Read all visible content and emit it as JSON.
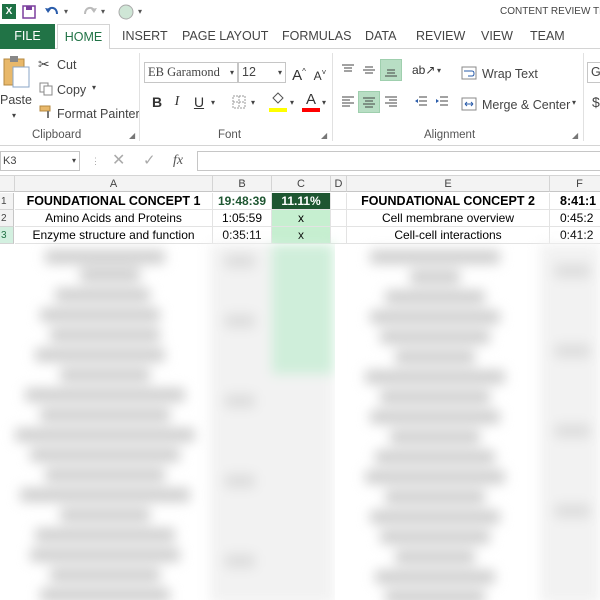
{
  "window": {
    "title": "CONTENT REVIEW TRA"
  },
  "quick_access": {
    "save_icon": "save-icon",
    "undo_icon": "undo-icon",
    "redo_icon": "redo-icon"
  },
  "tabs": [
    {
      "label": "FILE"
    },
    {
      "label": "HOME"
    },
    {
      "label": "INSERT"
    },
    {
      "label": "PAGE LAYOUT"
    },
    {
      "label": "FORMULAS"
    },
    {
      "label": "DATA"
    },
    {
      "label": "REVIEW"
    },
    {
      "label": "VIEW"
    },
    {
      "label": "TEAM"
    }
  ],
  "clipboard": {
    "paste": "Paste",
    "cut": "Cut",
    "copy": "Copy",
    "format_painter": "Format Painter",
    "group_label": "Clipboard"
  },
  "font": {
    "family": "EB Garamond",
    "size": "12",
    "bold": "B",
    "italic": "I",
    "underline": "U",
    "grow": "A",
    "shrink": "A",
    "font_color_letter": "A",
    "group_label": "Font",
    "highlight_color": "#ffff00",
    "font_color": "#ff0000"
  },
  "alignment": {
    "wrap_text": "Wrap Text",
    "merge_center": "Merge & Center",
    "group_label": "Alignment"
  },
  "number": {
    "partial_box": "Ge",
    "currency": "$"
  },
  "formula_bar": {
    "name_box": "K3",
    "fx": "fx",
    "formula": ""
  },
  "columns": [
    "A",
    "B",
    "C",
    "D",
    "E",
    "F"
  ],
  "rows": [
    "1",
    "2",
    "3"
  ],
  "sheet": {
    "concept1": {
      "title": "FOUNDATIONAL CONCEPT 1",
      "total_time": "19:48:39",
      "percent": "11.11%",
      "items": [
        {
          "topic": "Amino Acids and Proteins",
          "time": "1:05:59",
          "done": "x"
        },
        {
          "topic": "Enzyme structure and function",
          "time": "0:35:11",
          "done": "x"
        }
      ]
    },
    "concept2": {
      "title": "FOUNDATIONAL CONCEPT 2",
      "total_time": "8:41:1",
      "items": [
        {
          "topic": "Cell membrane overview",
          "time": "0:45:2"
        },
        {
          "topic": "Cell-cell interactions",
          "time": "0:41:2"
        }
      ]
    }
  },
  "colors": {
    "excel_green": "#217346",
    "dark_green": "#1e5631",
    "light_green": "#c6efd0"
  }
}
